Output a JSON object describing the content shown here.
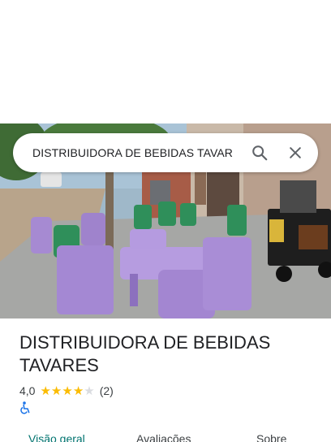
{
  "search": {
    "query": "DISTRIBUIDORA DE BEBIDAS TAVAR",
    "search_icon": "search-icon",
    "close_icon": "close-icon"
  },
  "place": {
    "name": "DISTRIBUIDORA DE BEBIDAS TAVARES",
    "rating": "4,0",
    "rating_value": 4.0,
    "stars_filled": 4,
    "stars_total": 5,
    "review_count": "(2)",
    "accessibility_icon": "wheelchair-icon"
  },
  "tabs": [
    {
      "label": "Visão geral",
      "active": true
    },
    {
      "label": "Avaliações",
      "active": false
    },
    {
      "label": "Sobre",
      "active": false
    }
  ],
  "colors": {
    "star": "#fbbc04",
    "accent": "#00736f",
    "access_icon": "#1a73e8"
  }
}
